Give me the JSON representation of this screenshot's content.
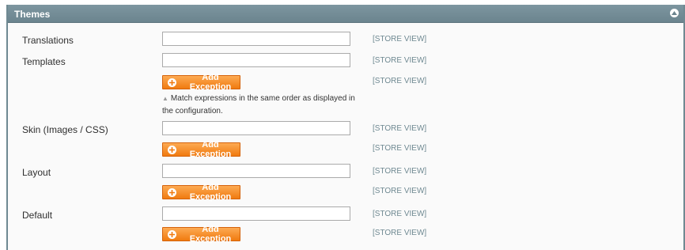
{
  "section": {
    "title": "Themes",
    "collapse_icon": "collapse-up-icon"
  },
  "scope_label": "[STORE VIEW]",
  "add_exception_label": "Add Exception",
  "add_icon": "plus-circle-icon",
  "colors": {
    "header_bg": "#6f8992",
    "button_orange": "#f38a1f",
    "scope_text": "#6f8992"
  },
  "fields": {
    "translations": {
      "label": "Translations",
      "value": ""
    },
    "templates": {
      "label": "Templates",
      "value": ""
    },
    "skin": {
      "label": "Skin (Images / CSS)",
      "value": ""
    },
    "layout": {
      "label": "Layout",
      "value": ""
    },
    "default": {
      "label": "Default",
      "value": ""
    }
  },
  "templates_note": "Match expressions in the same order as displayed in the configuration."
}
